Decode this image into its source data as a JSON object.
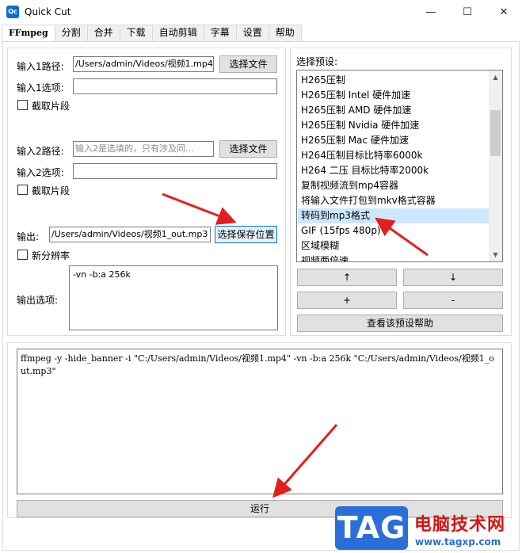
{
  "window": {
    "app_icon_text": "Qc",
    "title": "Quick Cut",
    "minimize": "—",
    "maximize": "☐",
    "close": "✕"
  },
  "tabs": [
    "FFmpeg",
    "分割",
    "合并",
    "下载",
    "自动剪辑",
    "字幕",
    "设置",
    "帮助"
  ],
  "left": {
    "input1_label": "输入1路径:",
    "input1_value": "/Users/admin/Videos/视频1.mp4",
    "input1_button": "选择文件",
    "input1_options_label": "输入1选项:",
    "input1_options_value": "",
    "clip1_label": "截取片段",
    "input2_label": "输入2路径:",
    "input2_placeholder": "输入2是选填的，只有涉及同…",
    "input2_button": "选择文件",
    "input2_options_label": "输入2选项:",
    "input2_options_value": "",
    "clip2_label": "截取片段",
    "output_label": "输出:",
    "output_value": "/Users/admin/Videos/视频1_out.mp3",
    "output_button": "选择保存位置",
    "resolution_label": "新分辨率",
    "output_options_label": "输出选项:",
    "output_options_value": "-vn -b:a 256k"
  },
  "right": {
    "preset_label": "选择预设:",
    "presets": [
      "H265压制",
      "H265压制 Intel 硬件加速",
      "H265压制 AMD 硬件加速",
      "H265压制 Nvidia 硬件加速",
      "H265压制 Mac 硬件加速",
      "H264压制目标比特率6000k",
      "H264 二压 目标比特率2000k",
      "复制视频流到mp4容器",
      "将输入文件打包到mkv格式容器",
      "转码到mp3格式",
      "GIF (15fps 480p)",
      "区域模糊",
      "视频两倍速"
    ],
    "selected_index": 9,
    "up_button": "↑",
    "down_button": "↓",
    "add_button": "+",
    "remove_button": "-",
    "help_button": "查看该预设帮助"
  },
  "command": "ffmpeg -y -hide_banner -i \"C:/Users/admin/Videos/视频1.mp4\" -vn -b:a 256k \"C:/Users/admin/Videos/视频1_out.mp3\"",
  "run_button": "运行",
  "watermark": {
    "logo": "TAG",
    "site_name": "电脑技术网",
    "url": "www.tagxp.com"
  },
  "colors": {
    "accent": "#0078d7",
    "selection": "#cce8ff",
    "annotation_arrow": "#e0201c"
  }
}
